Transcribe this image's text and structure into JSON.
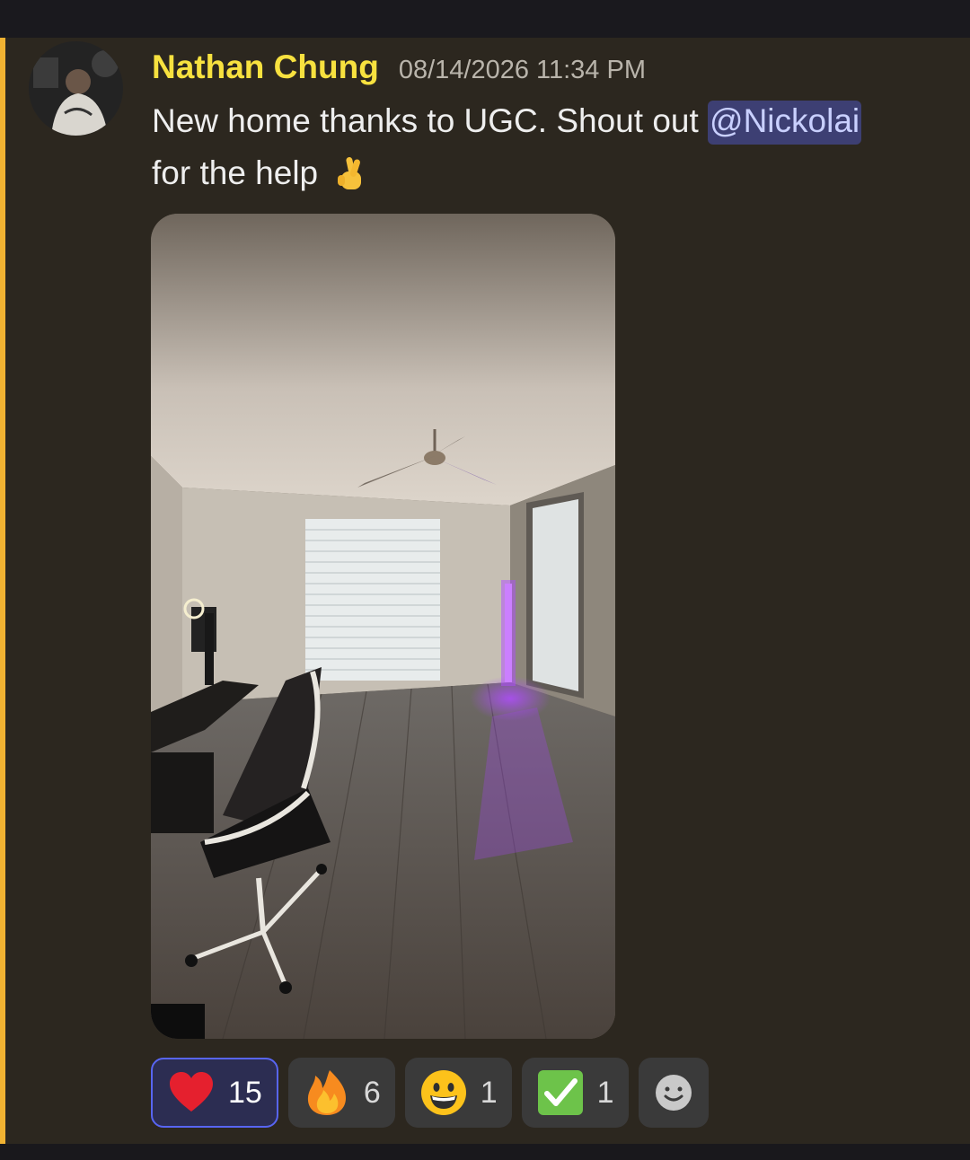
{
  "message": {
    "author": "Nathan Chung",
    "timestamp": "08/14/2026 11:34 PM",
    "text_before_mention": "New home thanks to UGC. Shout out ",
    "mention": "@Nickolai",
    "text_after_mention": "for the help",
    "inline_emoji": "crossed-fingers",
    "attachment": {
      "type": "image"
    },
    "colors": {
      "highlight_bar": "#f0b232",
      "username": "#f7e13f",
      "mention_bg": "#3d3f73",
      "active_reaction_border": "#5865f2"
    }
  },
  "reactions": [
    {
      "emoji": "heart-icon",
      "count": "15",
      "active": true
    },
    {
      "emoji": "fire-icon",
      "count": "6",
      "active": false
    },
    {
      "emoji": "grinning-face-icon",
      "count": "1",
      "active": false
    },
    {
      "emoji": "check-mark-icon",
      "count": "1",
      "active": false
    }
  ],
  "add_reaction": {
    "icon": "add-reaction-icon"
  }
}
